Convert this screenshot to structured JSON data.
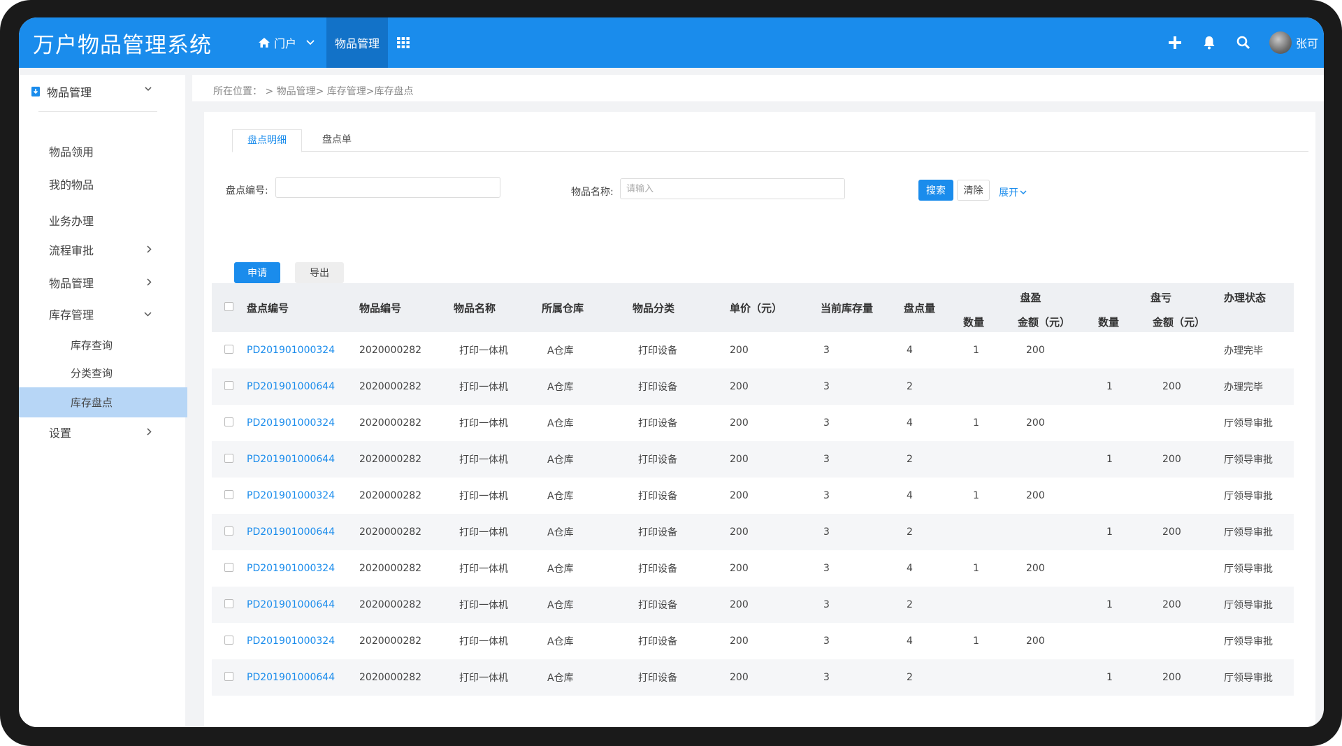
{
  "header": {
    "app_title": "万户物品管理系统",
    "nav": [
      {
        "label": "门户"
      },
      {
        "label": "物品管理"
      }
    ],
    "user_name": "张可"
  },
  "sidebar": {
    "section_title": "物品管理",
    "items": [
      {
        "label": "物品领用"
      },
      {
        "label": "我的物品"
      },
      {
        "label": "业务办理"
      },
      {
        "label": "流程审批"
      },
      {
        "label": "物品管理"
      },
      {
        "label": "库存管理"
      },
      {
        "label": "库存查询"
      },
      {
        "label": "分类查询"
      },
      {
        "label": "库存盘点"
      },
      {
        "label": "设置"
      }
    ]
  },
  "breadcrumb": "所在位置： > 物品管理> 库存管理>库存盘点",
  "tabs": [
    {
      "label": "盘点明细"
    },
    {
      "label": "盘点单"
    }
  ],
  "filters": {
    "code_label": "盘点编号:",
    "code_value": "",
    "name_label": "物品名称:",
    "name_placeholder": "请输入",
    "search_label": "搜索",
    "clear_label": "清除",
    "expand_label": "展开"
  },
  "actions": {
    "apply_label": "申请",
    "export_label": "导出"
  },
  "table": {
    "headers": {
      "code": "盘点编号",
      "item_no": "物品编号",
      "item_name": "物品名称",
      "warehouse": "所属仓库",
      "category": "物品分类",
      "price": "单价（元）",
      "stock": "当前库存量",
      "count": "盘点量",
      "surplus": "盘盈",
      "loss": "盘亏",
      "qty": "数量",
      "amount": "金额（元）",
      "status": "办理状态"
    },
    "rows": [
      {
        "code": "PD201901000324",
        "item_no": "2020000282",
        "item_name": "打印一体机",
        "warehouse": "A仓库",
        "category": "打印设备",
        "price": "200",
        "stock": "3",
        "count": "4",
        "surplus_qty": "1",
        "surplus_amount": "200",
        "loss_qty": "",
        "loss_amount": "",
        "status": "办理完毕"
      },
      {
        "code": "PD201901000644",
        "item_no": "2020000282",
        "item_name": "打印一体机",
        "warehouse": "A仓库",
        "category": "打印设备",
        "price": "200",
        "stock": "3",
        "count": "2",
        "surplus_qty": "",
        "surplus_amount": "",
        "loss_qty": "1",
        "loss_amount": "200",
        "status": "办理完毕"
      },
      {
        "code": "PD201901000324",
        "item_no": "2020000282",
        "item_name": "打印一体机",
        "warehouse": "A仓库",
        "category": "打印设备",
        "price": "200",
        "stock": "3",
        "count": "4",
        "surplus_qty": "1",
        "surplus_amount": "200",
        "loss_qty": "",
        "loss_amount": "",
        "status": "厅领导审批"
      },
      {
        "code": "PD201901000644",
        "item_no": "2020000282",
        "item_name": "打印一体机",
        "warehouse": "A仓库",
        "category": "打印设备",
        "price": "200",
        "stock": "3",
        "count": "2",
        "surplus_qty": "",
        "surplus_amount": "",
        "loss_qty": "1",
        "loss_amount": "200",
        "status": "厅领导审批"
      },
      {
        "code": "PD201901000324",
        "item_no": "2020000282",
        "item_name": "打印一体机",
        "warehouse": "A仓库",
        "category": "打印设备",
        "price": "200",
        "stock": "3",
        "count": "4",
        "surplus_qty": "1",
        "surplus_amount": "200",
        "loss_qty": "",
        "loss_amount": "",
        "status": "厅领导审批"
      },
      {
        "code": "PD201901000644",
        "item_no": "2020000282",
        "item_name": "打印一体机",
        "warehouse": "A仓库",
        "category": "打印设备",
        "price": "200",
        "stock": "3",
        "count": "2",
        "surplus_qty": "",
        "surplus_amount": "",
        "loss_qty": "1",
        "loss_amount": "200",
        "status": "厅领导审批"
      },
      {
        "code": "PD201901000324",
        "item_no": "2020000282",
        "item_name": "打印一体机",
        "warehouse": "A仓库",
        "category": "打印设备",
        "price": "200",
        "stock": "3",
        "count": "4",
        "surplus_qty": "1",
        "surplus_amount": "200",
        "loss_qty": "",
        "loss_amount": "",
        "status": "厅领导审批"
      },
      {
        "code": "PD201901000644",
        "item_no": "2020000282",
        "item_name": "打印一体机",
        "warehouse": "A仓库",
        "category": "打印设备",
        "price": "200",
        "stock": "3",
        "count": "2",
        "surplus_qty": "",
        "surplus_amount": "",
        "loss_qty": "1",
        "loss_amount": "200",
        "status": "厅领导审批"
      },
      {
        "code": "PD201901000324",
        "item_no": "2020000282",
        "item_name": "打印一体机",
        "warehouse": "A仓库",
        "category": "打印设备",
        "price": "200",
        "stock": "3",
        "count": "4",
        "surplus_qty": "1",
        "surplus_amount": "200",
        "loss_qty": "",
        "loss_amount": "",
        "status": "厅领导审批"
      },
      {
        "code": "PD201901000644",
        "item_no": "2020000282",
        "item_name": "打印一体机",
        "warehouse": "A仓库",
        "category": "打印设备",
        "price": "200",
        "stock": "3",
        "count": "2",
        "surplus_qty": "",
        "surplus_amount": "",
        "loss_qty": "1",
        "loss_amount": "200",
        "status": "厅领导审批"
      }
    ]
  },
  "icons": {
    "home": "home-icon",
    "apps": "grid-icon",
    "add": "plus-icon",
    "notifications": "bell-icon",
    "search": "search-icon",
    "section": "download-icon"
  },
  "colors": {
    "primary": "#1a8cec",
    "nav_active": "#1272c8",
    "sidebar_active": "#b7d6f6"
  }
}
